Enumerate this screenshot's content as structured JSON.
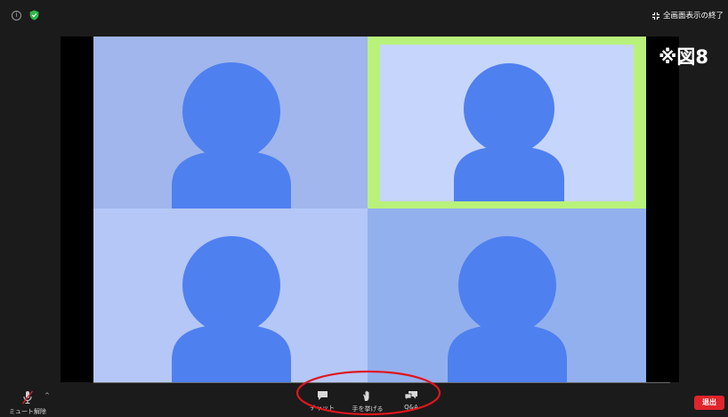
{
  "topbar": {
    "info_glyph": "i",
    "exit_fullscreen_label": "全画面表示の終了"
  },
  "figure_label": "※図8",
  "participants": [
    {
      "tile": 1,
      "background": "#a0b6ec",
      "active_speaker": false
    },
    {
      "tile": 2,
      "background": "#c6d5fb",
      "active_speaker": true,
      "highlight_color": "#b8f27a"
    },
    {
      "tile": 3,
      "background": "#b4c7f7",
      "active_speaker": false
    },
    {
      "tile": 4,
      "background": "#93b0ee",
      "active_speaker": false
    }
  ],
  "avatar_color": "#4f80ef",
  "controls": {
    "unmute_label": "ミュート解除",
    "chat_label": "チャット",
    "raise_hand_label": "手を挙げる",
    "qa_label": "Q&A",
    "leave_label": "退出"
  },
  "colors": {
    "leave_button": "#e0242b",
    "annotation_circle": "#e0161d",
    "shield": "#2fb84a"
  }
}
